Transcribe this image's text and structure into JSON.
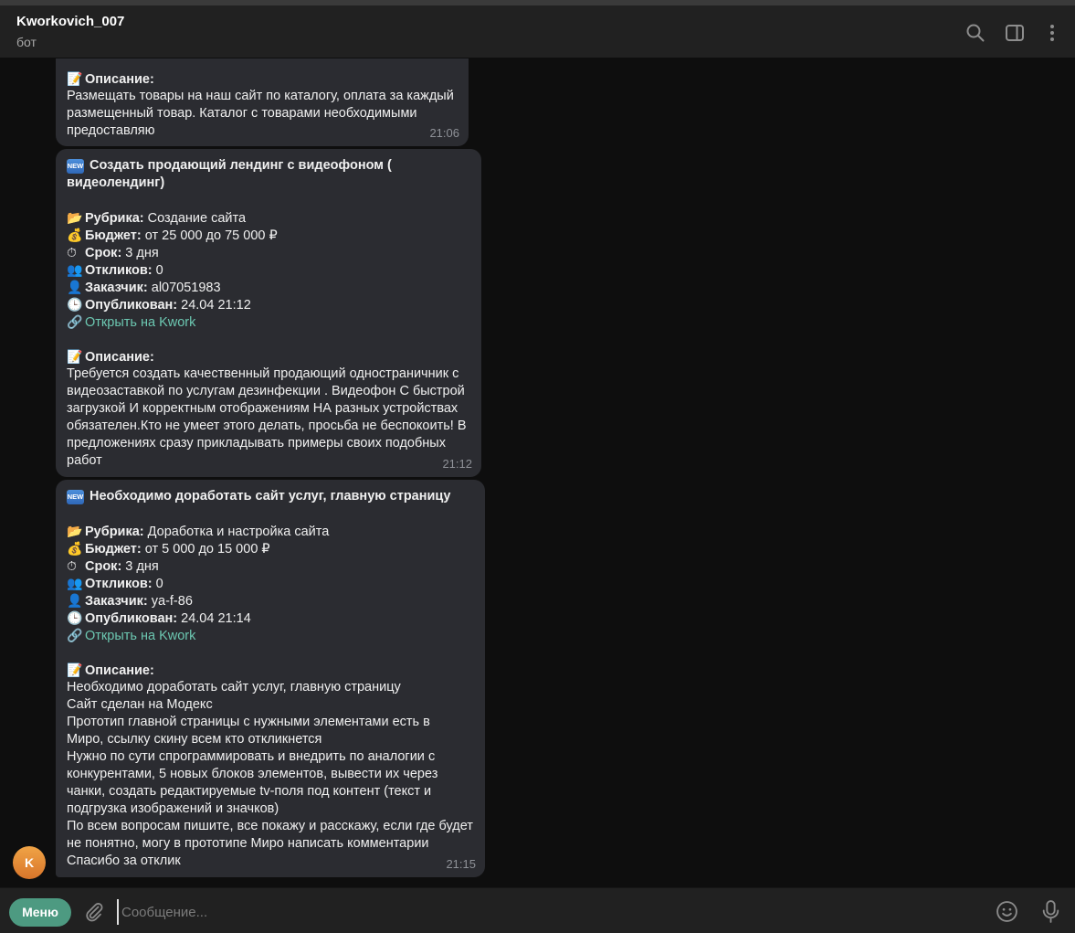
{
  "header": {
    "title": "Kworkovich_007",
    "subtitle": "бот"
  },
  "messages": {
    "m1": {
      "desc_label": "Описание:",
      "desc_lines": [
        "Размещать товары на наш сайт по каталогу, оплата за каждый",
        "размещенный товар. Каталог с товарами необходимыми",
        "предоставляю"
      ],
      "time": "21:06"
    },
    "m2": {
      "title_lines": [
        "Создать продающий лендинг с видеофоном (",
        "видеолендинг)"
      ],
      "rubric_label": "Рубрика:",
      "rubric": " Создание сайта",
      "budget_label": "Бюджет:",
      "budget": " от 25 000 до 75 000 ₽",
      "term_label": "Срок:",
      "term": " 3 дня",
      "responses_label": "Откликов:",
      "responses": " 0",
      "customer_label": "Заказчик:",
      "customer": " al07051983",
      "published_label": "Опубликован:",
      "published": " 24.04 21:12",
      "link": "Открыть на Kwork",
      "desc_label": "Описание:",
      "desc_lines": [
        "Требуется создать качественный продающий одностраничник с",
        "видеозаставкой по услугам дезинфекции . Видеофон С быстрой",
        "загрузкой И корректным отображениям НА разных устройствах",
        "обязателен.Кто не умеет этого делать, просьба не беспокоить! В",
        "предложениях сразу прикладывать примеры своих подобных",
        "работ"
      ],
      "time": "21:12"
    },
    "m3": {
      "title_lines": [
        "Необходимо доработать сайт услуг, главную страницу"
      ],
      "rubric_label": "Рубрика:",
      "rubric": " Доработка и настройка сайта",
      "budget_label": "Бюджет:",
      "budget": " от 5 000 до 15 000 ₽",
      "term_label": "Срок:",
      "term": " 3 дня",
      "responses_label": "Откликов:",
      "responses": " 0",
      "customer_label": "Заказчик:",
      "customer": " ya-f-86",
      "published_label": "Опубликован:",
      "published": " 24.04 21:14",
      "link": "Открыть на Kwork",
      "desc_label": "Описание:",
      "desc_lines": [
        "Необходимо доработать сайт услуг, главную страницу",
        "Сайт сделан на Модекс",
        "Прототип главной страницы с нужными элементами есть в",
        "Миро, ссылку скину всем кто откликнется",
        "Нужно по сути спрограммировать и внедрить по аналогии с",
        "конкурентами, 5 новых блоков элементов, вывести их через",
        "чанки, создать редактируемые tv-поля под контент (текст и",
        "подгрузка изображений и значков)",
        "По всем вопросам пишите, все покажу и расскажу, если где будет",
        "не понятно, могу в прототипе Миро написать комментарии",
        "Спасибо за отклик"
      ],
      "time": "21:15"
    }
  },
  "avatar_letter": "K",
  "composer": {
    "menu_label": "Меню",
    "placeholder": "Сообщение..."
  },
  "colors": {
    "accent": "#4d9a81",
    "link": "#6cc7b1",
    "bubble": "#2b2c31",
    "background": "#0e0e0e"
  }
}
